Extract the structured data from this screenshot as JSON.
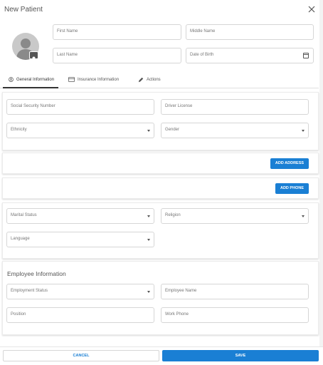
{
  "dialog": {
    "title": "New Patient"
  },
  "name_fields": {
    "first_name": "First Name",
    "middle_name": "Middle Name",
    "last_name": "Last Name",
    "dob": "Date of Birth"
  },
  "tabs": [
    {
      "label": "General Information",
      "icon": "person-circle-icon"
    },
    {
      "label": "Insurance Information",
      "icon": "credit-card-icon"
    },
    {
      "label": "Actions",
      "icon": "pencil-icon"
    }
  ],
  "general": {
    "ssn": "Social Security Number",
    "driver_license": "Driver License",
    "ethnicity": "Ethnicity",
    "gender": "Gender"
  },
  "address": {
    "add_label": "ADD ADDRESS"
  },
  "phone": {
    "add_label": "ADD PHONE"
  },
  "demographics": {
    "marital_status": "Marital Status",
    "religion": "Religion",
    "language": "Language"
  },
  "employee": {
    "title": "Employee Information",
    "status": "Employment Status",
    "name": "Employee Name",
    "position": "Position",
    "work_phone": "Work Phone"
  },
  "footer": {
    "cancel": "CANCEL",
    "save": "SAVE"
  },
  "colors": {
    "accent": "#1a7fd4"
  }
}
